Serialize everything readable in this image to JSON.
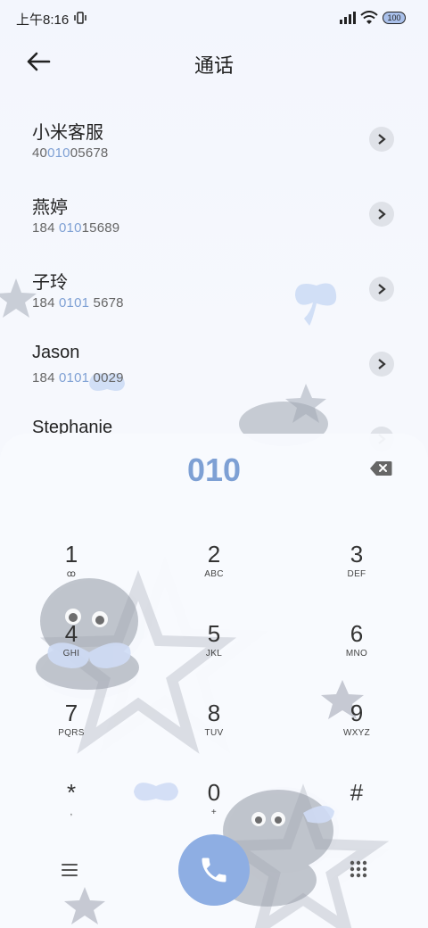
{
  "status_bar": {
    "time": "上午8:16",
    "battery": "100"
  },
  "header": {
    "title": "通话"
  },
  "contacts": [
    {
      "name": "小米客服",
      "num_pre": "40",
      "num_hl": "010",
      "num_post": "05678"
    },
    {
      "name": "燕婷",
      "num_pre": "184 ",
      "num_hl": "010",
      "num_post": "15689"
    },
    {
      "name": "子玲",
      "num_pre": "184 ",
      "num_hl": "0101",
      "num_post": " 5678"
    },
    {
      "name": "Jason",
      "num_pre": "184 ",
      "num_hl": "0101",
      "num_post": " 0029"
    },
    {
      "name": "Stephanie",
      "num_pre": "",
      "num_hl": "",
      "num_post": ""
    }
  ],
  "dialer": {
    "input": "010",
    "keys": [
      {
        "digit": "1",
        "letters": "ꝏ"
      },
      {
        "digit": "2",
        "letters": "ABC"
      },
      {
        "digit": "3",
        "letters": "DEF"
      },
      {
        "digit": "4",
        "letters": "GHI"
      },
      {
        "digit": "5",
        "letters": "JKL"
      },
      {
        "digit": "6",
        "letters": "MNO"
      },
      {
        "digit": "7",
        "letters": "PQRS"
      },
      {
        "digit": "8",
        "letters": "TUV"
      },
      {
        "digit": "9",
        "letters": "WXYZ"
      },
      {
        "digit": "*",
        "letters": ","
      },
      {
        "digit": "0",
        "letters": "+"
      },
      {
        "digit": "#",
        "letters": ""
      }
    ]
  },
  "colors": {
    "accent": "#7ea0d4",
    "call_button": "#8eaee3"
  },
  "icons": {
    "back": "arrow-left-icon",
    "contact_detail": "chevron-right-icon",
    "backspace": "backspace-icon",
    "menu": "menu-icon",
    "call": "phone-icon",
    "dialpad": "dialpad-icon"
  }
}
